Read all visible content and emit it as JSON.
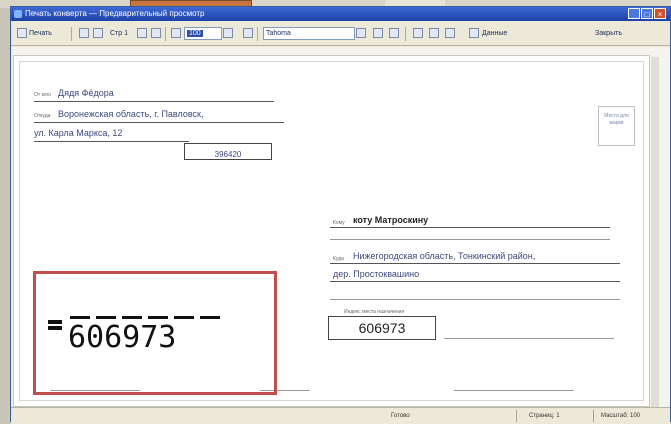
{
  "window": {
    "title": "Печать конверта — Предварительный просмотр"
  },
  "toolbar": {
    "print_label": "Печать",
    "page_label": "Стр 1",
    "zoom_value": "100",
    "font_value": "Tahoma",
    "data_label": "Данные",
    "close_label": "Закрыть"
  },
  "envelope": {
    "from_caption": "От кого",
    "from_value": "Дядя Фёдора",
    "from_addr_caption": "Откуда",
    "from_addr_line1": "Воронежская область, г. Павловск,",
    "from_addr_line2": "ул. Карла Маркса, 12",
    "from_zip": "396420",
    "stamp_text": "Место для марки",
    "to_caption": "Кому",
    "to_value": "коту Матроскину",
    "to_addr_caption": "Куда",
    "to_addr_line1": "Нижегородская область, Тонкинский район,",
    "to_addr_line2": "дер. Простоквашино",
    "to_zip_caption": "Индекс места назначения",
    "to_zip": "606973",
    "barcode_digits": "606973"
  },
  "status": {
    "ready": "Готово",
    "pages": "Страниц: 1",
    "scale": "Масштаб: 100"
  }
}
